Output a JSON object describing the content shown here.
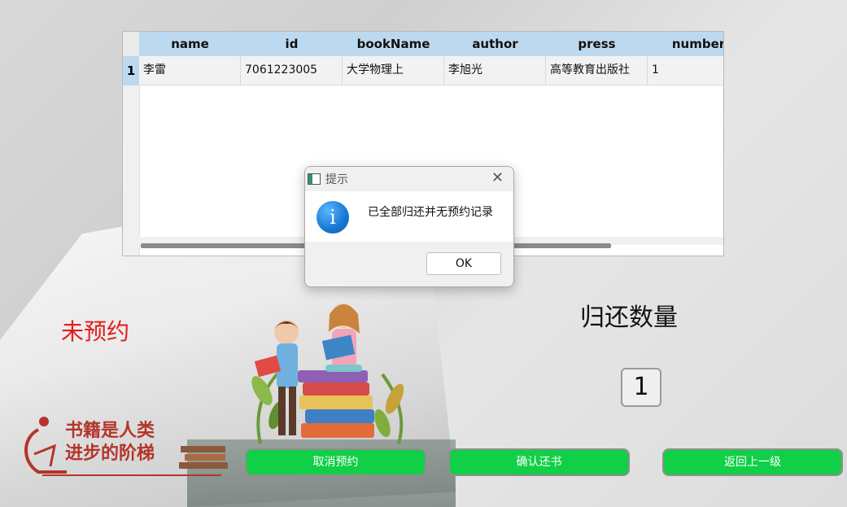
{
  "table": {
    "columns": [
      "name",
      "id",
      "bookName",
      "author",
      "press",
      "number"
    ],
    "row_number": "1",
    "rows": [
      [
        "李雷",
        "7061223005",
        "大学物理上",
        "李旭光",
        "高等教育出版社",
        "1"
      ]
    ]
  },
  "dialog": {
    "title": "提示",
    "message": "已全部归还并无预约记录",
    "ok_label": "OK",
    "close_symbol": "✕",
    "info_symbol": "i"
  },
  "status_label": "未预约",
  "return_count": {
    "title": "归还数量",
    "value": "1"
  },
  "slogan": {
    "line1": "书籍是人类",
    "line2": "进步的阶梯"
  },
  "buttons": {
    "cancel_reservation": "取消预约",
    "confirm_return": "确认还书",
    "back": "返回上一级"
  },
  "colors": {
    "button_green": "#11cf47",
    "header_blue": "#bcd9ef",
    "status_red": "#e51b1b",
    "slogan_red": "#b3352a"
  },
  "icons": [
    "window-icon",
    "close-icon",
    "info-icon"
  ]
}
